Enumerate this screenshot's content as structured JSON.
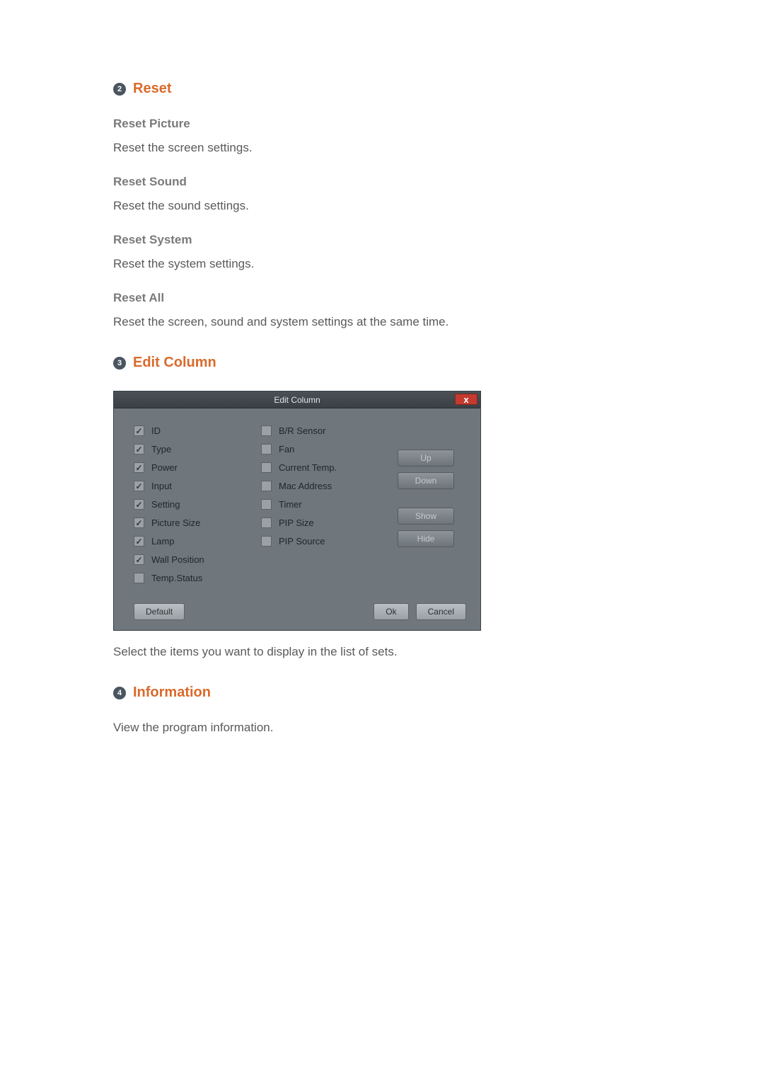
{
  "sections": {
    "reset": {
      "num": "2",
      "title": "Reset",
      "items": [
        {
          "heading": "Reset Picture",
          "text": "Reset the screen settings."
        },
        {
          "heading": "Reset Sound",
          "text": "Reset the sound settings."
        },
        {
          "heading": "Reset System",
          "text": "Reset the system settings."
        },
        {
          "heading": "Reset All",
          "text": "Reset the screen, sound and system settings at the same time."
        }
      ]
    },
    "edit_column": {
      "num": "3",
      "title": "Edit Column",
      "caption": "Select the items you want to display in the list of sets."
    },
    "information": {
      "num": "4",
      "title": "Information",
      "text": "View the program information."
    }
  },
  "dialog": {
    "title": "Edit Column",
    "close": "x",
    "left_col": [
      {
        "label": "ID",
        "checked": true
      },
      {
        "label": "Type",
        "checked": true
      },
      {
        "label": "Power",
        "checked": true
      },
      {
        "label": "Input",
        "checked": true
      },
      {
        "label": "Setting",
        "checked": true
      },
      {
        "label": "Picture Size",
        "checked": true
      },
      {
        "label": "Lamp",
        "checked": true
      },
      {
        "label": "Wall Position",
        "checked": true
      },
      {
        "label": "Temp.Status",
        "checked": false
      }
    ],
    "mid_col": [
      {
        "label": "B/R Sensor",
        "checked": false
      },
      {
        "label": "Fan",
        "checked": false
      },
      {
        "label": "Current Temp.",
        "checked": false
      },
      {
        "label": "Mac Address",
        "checked": false
      },
      {
        "label": "Timer",
        "checked": false
      },
      {
        "label": "PIP Size",
        "checked": false
      },
      {
        "label": "PIP Source",
        "checked": false
      }
    ],
    "side_buttons": {
      "up": "Up",
      "down": "Down",
      "show": "Show",
      "hide": "Hide"
    },
    "footer": {
      "default": "Default",
      "ok": "Ok",
      "cancel": "Cancel"
    }
  }
}
